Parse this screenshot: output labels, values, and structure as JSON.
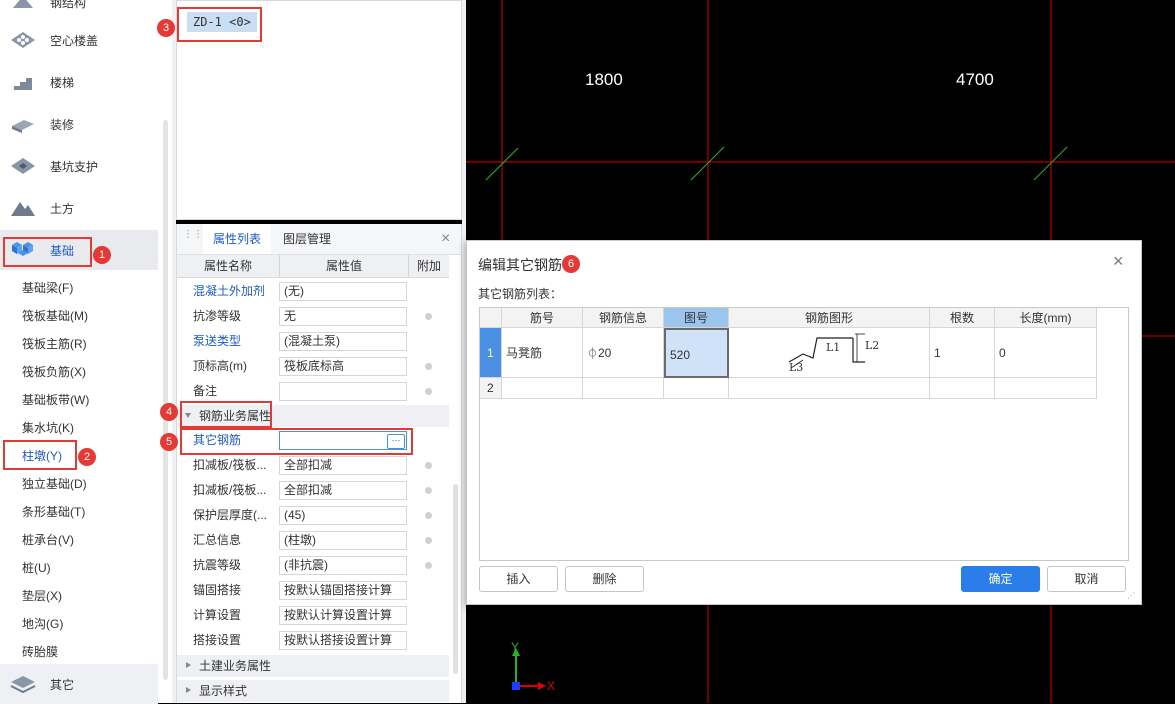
{
  "sidebar": {
    "categories": [
      {
        "label": "钢结构",
        "icon": "steel-structure-icon"
      },
      {
        "label": "空心楼盖",
        "icon": "hollow-floor-icon"
      },
      {
        "label": "楼梯",
        "icon": "stairs-icon"
      },
      {
        "label": "装修",
        "icon": "decoration-icon"
      },
      {
        "label": "基坑支护",
        "icon": "pit-support-icon"
      },
      {
        "label": "土方",
        "icon": "earthwork-icon"
      },
      {
        "label": "基础",
        "icon": "foundation-icon"
      },
      {
        "label": "其它",
        "icon": "other-icon"
      }
    ],
    "sub_items": [
      "基础梁(F)",
      "筏板基础(M)",
      "筏板主筋(R)",
      "筏板负筋(X)",
      "基础板带(W)",
      "集水坑(K)",
      "柱墩(Y)",
      "独立基础(D)",
      "条形基础(T)",
      "桩承台(V)",
      "桩(U)",
      "垫层(X)",
      "地沟(G)",
      "砖胎膜"
    ]
  },
  "callouts": [
    "1",
    "2",
    "3",
    "4",
    "5",
    "6"
  ],
  "component_list": {
    "selected_item": "ZD-1 <0>"
  },
  "properties": {
    "tabs": [
      "属性列表",
      "图层管理"
    ],
    "close_label": "×",
    "headers": {
      "name": "属性名称",
      "value": "属性值",
      "extra": "附加"
    },
    "rows": [
      {
        "name": "混凝土外加剂",
        "value": "(无)"
      },
      {
        "name": "抗渗等级",
        "value": "无"
      },
      {
        "name": "泵送类型",
        "value": "(混凝土泵)"
      },
      {
        "name": "顶标高(m)",
        "value": "筏板底标高"
      },
      {
        "name": "备注",
        "value": ""
      }
    ],
    "group_rebar": "钢筋业务属性",
    "rebar_rows": [
      {
        "name": "其它钢筋",
        "value": ""
      },
      {
        "name": "扣减板/筏板...",
        "value": "全部扣减"
      },
      {
        "name": "扣减板/筏板...",
        "value": "全部扣减"
      },
      {
        "name": "保护层厚度(...",
        "value": "(45)"
      },
      {
        "name": "汇总信息",
        "value": "(柱墩)"
      },
      {
        "name": "抗震等级",
        "value": "(非抗震)"
      },
      {
        "name": "锚固搭接",
        "value": "按默认锚固搭接计算"
      },
      {
        "name": "计算设置",
        "value": "按默认计算设置计算"
      },
      {
        "name": "搭接设置",
        "value": "按默认搭接设置计算"
      }
    ],
    "group_civil": "土建业务属性",
    "group_display": "显示样式",
    "ellipsis": "···"
  },
  "cad": {
    "dims": [
      "1800",
      "4700"
    ],
    "axis_y": "Y",
    "axis_x": "X"
  },
  "dialog": {
    "title": "编辑其它钢筋",
    "list_label": "其它钢筋列表：",
    "columns": [
      "筋号",
      "钢筋信息",
      "图号",
      "钢筋图形",
      "根数",
      "长度(mm)"
    ],
    "rows": [
      {
        "index": "1",
        "bar": "马凳筋",
        "info": "20",
        "info_symbol": "⏀",
        "fig_no": "520",
        "shape_labels": [
          "L1",
          "L2",
          "L3"
        ],
        "count": "1",
        "length": "0"
      },
      {
        "index": "2",
        "bar": "",
        "info": "",
        "info_symbol": "",
        "fig_no": "",
        "shape_labels": [],
        "count": "",
        "length": ""
      }
    ],
    "buttons": {
      "insert": "插入",
      "delete": "删除",
      "ok": "确定",
      "cancel": "取消"
    },
    "close_label": "×"
  }
}
